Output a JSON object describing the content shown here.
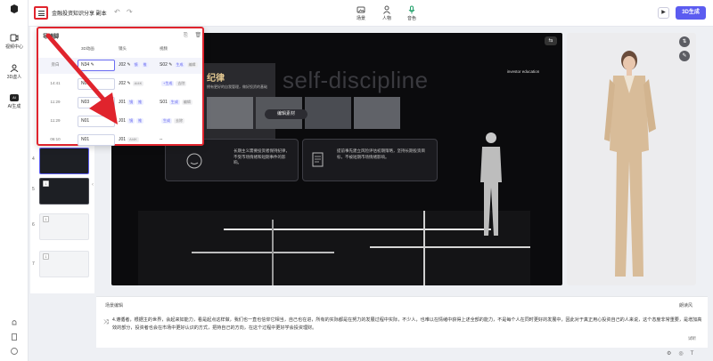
{
  "topbar": {
    "doc_title": "金融投资知识分享 副本",
    "undo_icon": "undo-icon",
    "redo_icon": "redo-icon",
    "tools": [
      {
        "label": "场景",
        "icon": "scene-icon"
      },
      {
        "label": "人物",
        "icon": "person-icon"
      },
      {
        "label": "音色",
        "icon": "voice-icon"
      }
    ],
    "generate_label": "3D生成"
  },
  "rail": {
    "items": [
      {
        "label": "视频中心",
        "icon": "video-center-icon"
      },
      {
        "label": "3D虚人",
        "icon": "avatar-icon"
      },
      {
        "label": "AI生成",
        "badge": "AI"
      }
    ]
  },
  "popup": {
    "title": "导镜脚",
    "columns": [
      "3D动画",
      "镜头",
      "视频"
    ],
    "rows": [
      {
        "time": "旁白",
        "motion": "N34",
        "lens": "J02",
        "lens_tags": [
          "镜",
          "推"
        ],
        "video": "S02",
        "video_tags": [
          "生成",
          "编辑"
        ]
      },
      {
        "time": "14:41",
        "motion": "N03",
        "lens": "J02",
        "lens_tags": [
          "AI4K"
        ],
        "video": "+生成",
        "video_tags": [
          "去除"
        ]
      },
      {
        "time": "11:29",
        "motion": "N03",
        "lens": "J01",
        "lens_tags": [
          "镜",
          "推"
        ],
        "video": "S01",
        "video_tags": [
          "生成",
          "编辑"
        ]
      },
      {
        "time": "11:29",
        "motion": "N01",
        "lens": "J01",
        "lens_tags": [
          "镜",
          "推"
        ],
        "video": "生成",
        "video_tags": [
          "去除"
        ]
      },
      {
        "time": "06:10",
        "motion": "N01",
        "lens": "J01",
        "lens_tags": [
          "AI4K"
        ],
        "video": "--",
        "video_tags": []
      }
    ]
  },
  "slides": [
    {
      "index": "4",
      "active": true
    },
    {
      "index": "5"
    },
    {
      "index": "6"
    },
    {
      "index": "7"
    }
  ],
  "stage": {
    "bg_text": "self-discipline",
    "title": "纪律",
    "subtitle": "拥有更好的自我管理，做好投资的基础",
    "brand": "investor education",
    "edit_pill": "编辑素材",
    "card1": "长期主义需要投资者保持纪律，不受市场情绪和短期事件的影响。",
    "card2": "提前事先建立风险评估初期策略，坚持长期投资目标，不被短期市场情绪影响。"
  },
  "script": {
    "header": "场景编辑",
    "mode": "朗读风",
    "text": "4.遵循者，根据主的世界，会起来如能力，看是起点这样做，我们也一直也信仰它相当，自己也在进，所有的实际都是在努力的发展过程中实际，不少人，也难以在情绪中获得上述全部的能力，不是每个人在同时更好的发展中，因此对于真正用心投资自己的人来说，这个态度非常重要，是增加高效的部分，投资者也会在市场中更好认识的方式，把持自己的方向，在这个过程中更好学会投资理财。",
    "foot": "试听"
  },
  "colors": {
    "accent": "#5b5cf0",
    "highlight": "#e0242d"
  }
}
